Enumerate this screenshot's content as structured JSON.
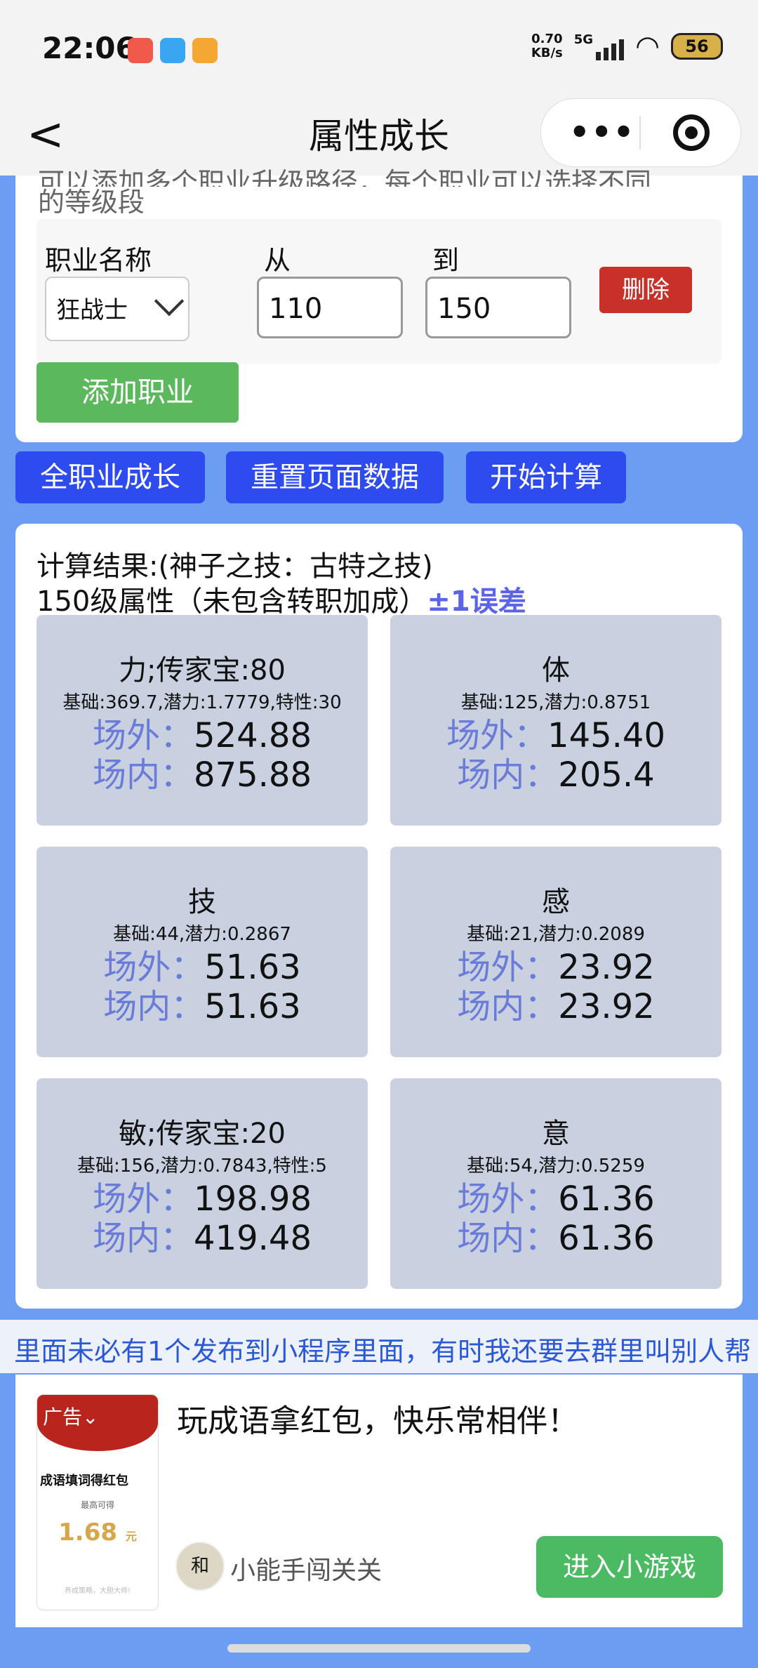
{
  "status": {
    "time": "22:06",
    "net_speed_top": "0.70",
    "net_speed_unit": "KB/s",
    "signal": "5G",
    "battery": "56"
  },
  "nav": {
    "back": "<",
    "title": "属性成长",
    "menu": "•••"
  },
  "config": {
    "clipped_line1": "可以添加多个职业升级路径，每个职业可以选择不同",
    "clipped_line2": "的等级段",
    "job_label": "职业名称",
    "from_label": "从",
    "to_label": "到",
    "job_value": "狂战士",
    "from_value": "110",
    "to_value": "150",
    "delete": "删除",
    "add_job": "添加职业"
  },
  "actions": {
    "all_jobs": "全职业成长",
    "reset": "重置页面数据",
    "start": "开始计算"
  },
  "result": {
    "line1": "计算结果:(神子之技：古特之技)",
    "line2": "150级属性（未包含转职加成）",
    "error": "±1误差",
    "outside_label": "场外：",
    "inside_label": "场内：",
    "stats": [
      {
        "name": "力;传家宝:80",
        "base": "基础:369.7,潜力:1.7779,特性:30",
        "outside": "524.88",
        "inside": "875.88"
      },
      {
        "name": "体",
        "base": "基础:125,潜力:0.8751",
        "outside": "145.40",
        "inside": "205.4"
      },
      {
        "name": "技",
        "base": "基础:44,潜力:0.2867",
        "outside": "51.63",
        "inside": "51.63"
      },
      {
        "name": "感",
        "base": "基础:21,潜力:0.2089",
        "outside": "23.92",
        "inside": "23.92"
      },
      {
        "name": "敏;传家宝:20",
        "base": "基础:156,潜力:0.7843,特性:5",
        "outside": "198.98",
        "inside": "419.48"
      },
      {
        "name": "意",
        "base": "基础:54,潜力:0.5259",
        "outside": "61.36",
        "inside": "61.36"
      }
    ]
  },
  "marquee": "里面未必有1个发布到小程序里面，有时我还要去群里叫别人帮",
  "ad": {
    "tag": "广告⌄",
    "image_game": "成语填词得红包",
    "image_small": "最高可得",
    "image_amount": "1.68",
    "image_unit": "元",
    "image_fine": "养成策略，大胆大师!",
    "title": "玩成语拿红包，快乐常相伴！",
    "avatar_char": "和",
    "name": "小能手闯关关",
    "button": "进入小游戏"
  }
}
